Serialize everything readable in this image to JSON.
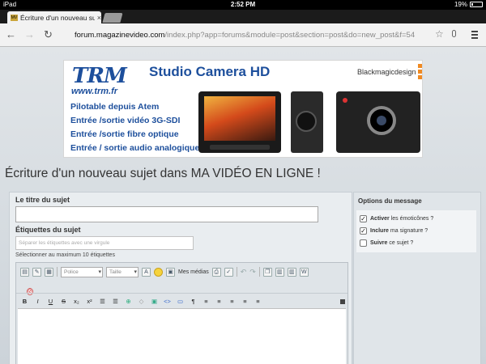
{
  "status_bar": {
    "device": "iPad",
    "time": "2:52 PM",
    "battery": "19%"
  },
  "tab": {
    "title": "Écriture d'un nouveau sujet",
    "favicon": "MV",
    "close": "×"
  },
  "toolbar": {
    "url_host": "forum.magazinevideo.com",
    "url_path": "/index.php?app=forums&module=post&section=post&do=new_post&f=54"
  },
  "banner": {
    "brand": "TRM",
    "url": "www.trm.fr",
    "product": "Studio Camera HD",
    "partner": "Blackmagicdesign",
    "features": [
      "Pilotable depuis Atem",
      "Entrée /sortie vidéo 3G-SDI",
      "Entrée /sortie fibre optique",
      "Entrée / sortie audio analogique"
    ]
  },
  "page_title": "Écriture d'un nouveau sujet dans MA VIDÉO EN LIGNE !",
  "form": {
    "title_label": "Le titre du sujet",
    "title_value": "",
    "tags_label": "Étiquettes du sujet",
    "tags_placeholder": "Séparer les étiquettes avec une virgule",
    "tags_hint": "Sélectionner au maximum 10 étiquettes"
  },
  "editor": {
    "font_select": "Police",
    "size_select": "Taille",
    "media_label": "Mes médias",
    "format_buttons": [
      "B",
      "I",
      "U",
      "S",
      "x₂",
      "x²",
      "☰",
      "☰",
      "⊕",
      "◇",
      "▣",
      "<>",
      "▭",
      "¶",
      "≡",
      "≡",
      "≡",
      "≡",
      "≡"
    ]
  },
  "options": {
    "title": "Options du message",
    "items": [
      {
        "bold": "Activer",
        "rest": " les émoticônes ?",
        "checked": true
      },
      {
        "bold": "Inclure",
        "rest": " ma signature ?",
        "checked": true
      },
      {
        "bold": "Suivre",
        "rest": " ce sujet ?",
        "checked": false
      }
    ]
  },
  "colors": {
    "brand_blue": "#1d4f9c",
    "accent_orange": "#f08a22",
    "page_bg": "#d5dbe0"
  }
}
